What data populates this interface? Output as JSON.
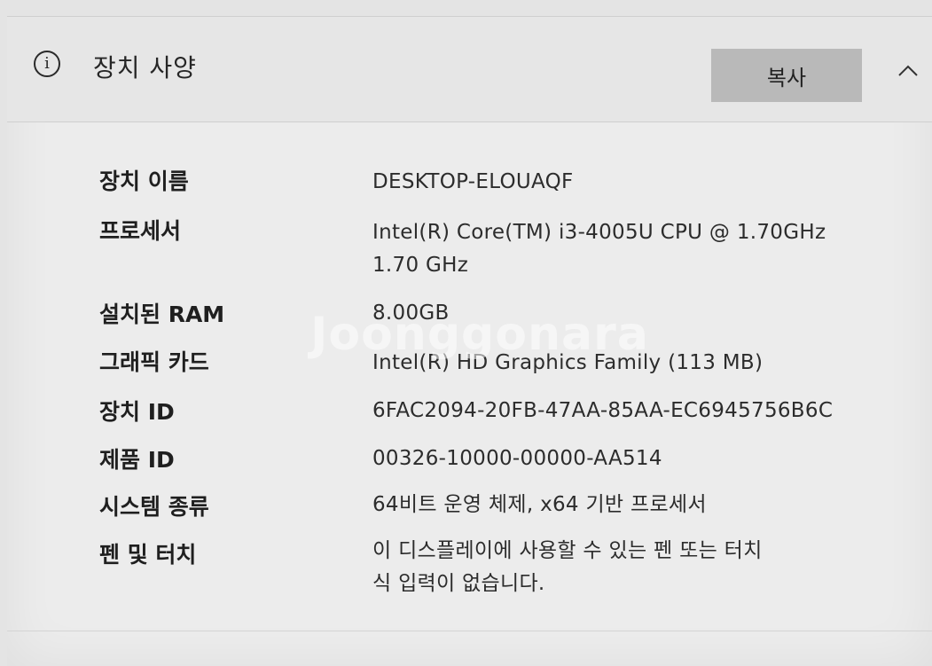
{
  "header": {
    "icon": "info-icon",
    "icon_glyph": "i",
    "title": "장치 사양",
    "copy_label": "복사",
    "collapse_icon": "chevron-up-icon"
  },
  "specs": [
    {
      "label": "장치 이름",
      "value": "DESKTOP-ELOUAQF"
    },
    {
      "label": "프로세서",
      "value": "Intel(R) Core(TM) i3-4005U CPU @ 1.70GHz\n1.70 GHz"
    },
    {
      "label": "설치된 RAM",
      "value": "8.00GB"
    },
    {
      "label": "그래픽 카드",
      "value": "Intel(R) HD Graphics Family (113 MB)"
    },
    {
      "label": "장치 ID",
      "value": "6FAC2094-20FB-47AA-85AA-EC6945756B6C"
    },
    {
      "label": "제품 ID",
      "value": "00326-10000-00000-AA514"
    },
    {
      "label": "시스템 종류",
      "value": "64비트 운영 체제, x64 기반 프로세서"
    },
    {
      "label": "펜 및 터치",
      "value": "이 디스플레이에 사용할 수 있는 펜 또는 터치\n식 입력이 없습니다."
    }
  ],
  "watermark": "Joonggonara"
}
